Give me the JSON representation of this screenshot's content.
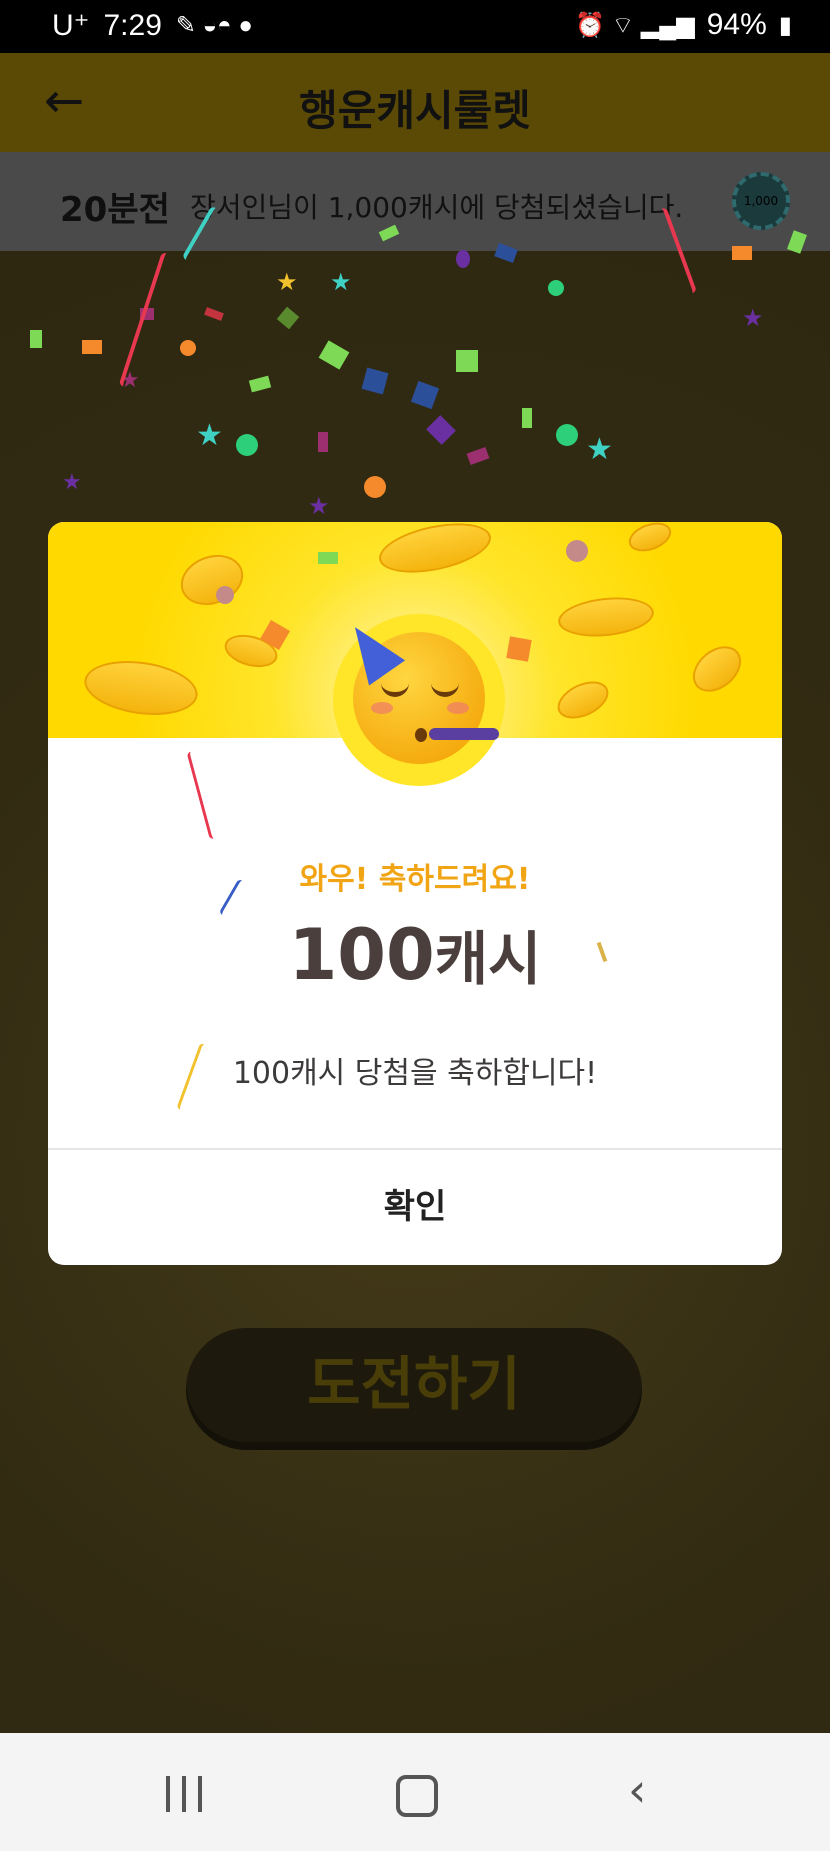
{
  "status_bar": {
    "carrier": "U⁺",
    "time": "7:29",
    "battery": "94%"
  },
  "header": {
    "title": "행운캐시룰렛"
  },
  "ticker": {
    "time_ago": "20분전",
    "message": "장서인님이 1,000캐시에 당첨되셨습니다.",
    "badge": "1,000"
  },
  "challenge_button": {
    "label": "도전하기"
  },
  "dialog": {
    "greeting": "와우! 축하드려요!",
    "amount_number": "100",
    "amount_unit": "캐시",
    "description": "100캐시 당첨을 축하합니다!",
    "confirm_label": "확인"
  },
  "colors": {
    "accent_yellow": "#ffd900",
    "greeting_orange": "#f2a514",
    "amount_text": "#4a3f3d"
  }
}
